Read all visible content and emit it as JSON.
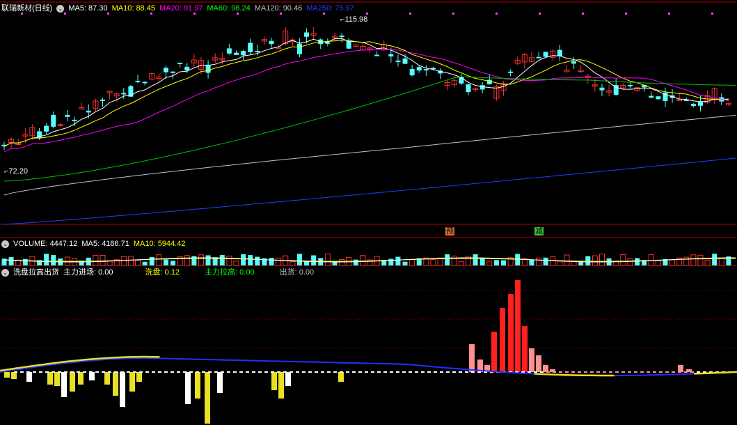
{
  "main": {
    "title": "联瑞新材(日线)",
    "ma": [
      {
        "label": "MA5: 87.30",
        "color": "#ffffff"
      },
      {
        "label": "MA10: 88.45",
        "color": "#ffff00"
      },
      {
        "label": "MA20: 91.97",
        "color": "#ff00ff"
      },
      {
        "label": "MA60: 98.24",
        "color": "#00ff00"
      },
      {
        "label": "MA120: 90.46",
        "color": "#c0c0c0"
      },
      {
        "label": "MA250: 75.97",
        "color": "#2040ff"
      }
    ],
    "high_label": "115.98",
    "low_label": "72.20",
    "signals": [
      {
        "text": "预",
        "color": "#e07030"
      },
      {
        "text": "减",
        "color": "#40c040"
      }
    ]
  },
  "volume": {
    "title": "VOLUME: 4447.12",
    "ma5": "MA5: 4186.71",
    "ma10": "MA10: 5944.42"
  },
  "indicator": {
    "title": "洗盘拉高出货",
    "items": [
      {
        "label": "主力进场: 0.00",
        "color": "#ffffff"
      },
      {
        "label": "洗盘: 0.12",
        "color": "#ffff00"
      },
      {
        "label": "主力拉高: 0.00",
        "color": "#00ff00"
      },
      {
        "label": "出货: 0.00",
        "color": "#c0c0c0"
      }
    ]
  },
  "colors": {
    "up": "#ff3030",
    "down": "#54ffff",
    "grid": "#b00000"
  }
}
